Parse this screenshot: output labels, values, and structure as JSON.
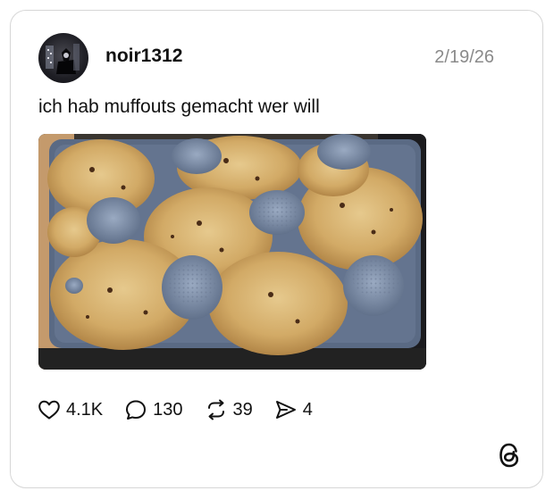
{
  "post": {
    "username": "noir1312",
    "date": "2/19/26",
    "text": "ich hab muffouts gemacht wer will",
    "image_description_icon": "photo"
  },
  "actions": {
    "likes": "4.1K",
    "replies": "130",
    "reposts": "39",
    "shares": "4"
  },
  "icons": {
    "like": "heart-icon",
    "reply": "speech-bubble-icon",
    "repost": "repost-icon",
    "share": "send-icon",
    "brand": "threads-logo-icon"
  }
}
